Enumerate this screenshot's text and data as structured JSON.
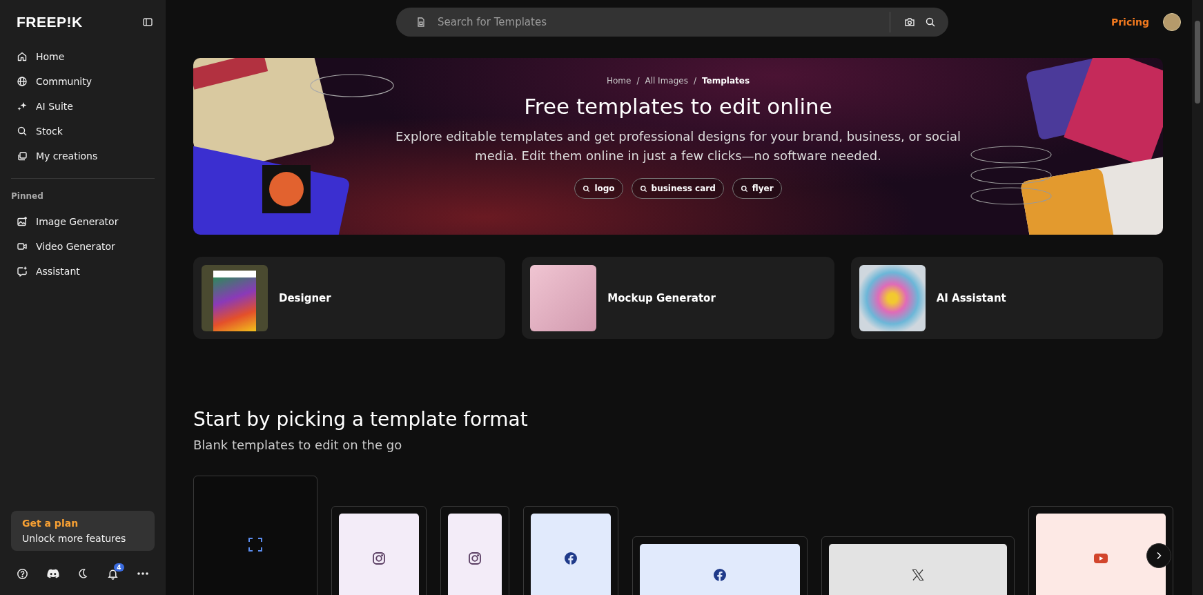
{
  "sidebar": {
    "logo": "FREEP!K",
    "nav": [
      {
        "label": "Home",
        "kind": "home"
      },
      {
        "label": "Community",
        "kind": "globe"
      },
      {
        "label": "AI Suite",
        "kind": "sparkle"
      },
      {
        "label": "Stock",
        "kind": "search"
      },
      {
        "label": "My creations",
        "kind": "stack"
      }
    ],
    "pinned_heading": "Pinned",
    "pinned": [
      {
        "label": "Image Generator",
        "kind": "image"
      },
      {
        "label": "Video Generator",
        "kind": "video"
      },
      {
        "label": "Assistant",
        "kind": "chat"
      }
    ],
    "plan": {
      "title": "Get a plan",
      "subtitle": "Unlock more features"
    },
    "notification_count": "4"
  },
  "header": {
    "search": {
      "placeholder": "Search for Templates"
    },
    "pricing": "Pricing"
  },
  "banner": {
    "breadcrumb": [
      {
        "label": "Home",
        "current": false
      },
      {
        "label": "All Images",
        "current": false
      },
      {
        "label": "Templates",
        "current": true
      }
    ],
    "separator": "/",
    "title": "Free templates to edit online",
    "description": "Explore editable templates and get professional designs for your brand, business, or social media. Edit them online in just a few clicks—no software needed.",
    "tags": [
      "logo",
      "business card",
      "flyer"
    ]
  },
  "tools": [
    {
      "label": "Designer",
      "kind": "designer"
    },
    {
      "label": "Mockup Generator",
      "kind": "mockup"
    },
    {
      "label": "AI Assistant",
      "kind": "assistant"
    }
  ],
  "section": {
    "title": "Start by picking a template format",
    "subtitle": "Blank templates to edit on the go"
  },
  "formats": [
    {
      "kind": "custom"
    },
    {
      "kind": "instagram-post"
    },
    {
      "kind": "instagram-story"
    },
    {
      "kind": "facebook-post"
    },
    {
      "kind": "facebook-cover"
    },
    {
      "kind": "x-header"
    },
    {
      "kind": "youtube-thumbnail"
    }
  ]
}
